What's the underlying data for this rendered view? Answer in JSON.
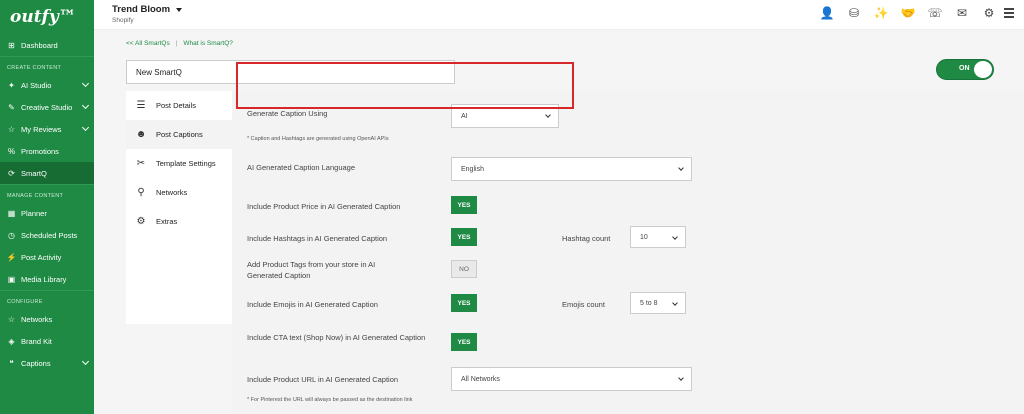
{
  "brand": {
    "logo": "outfy™"
  },
  "sidebar": {
    "items": [
      {
        "label": "Dashboard",
        "icon": "dashboard-icon"
      },
      {
        "section": "CREATE CONTENT"
      },
      {
        "label": "AI Studio",
        "icon": "ai-icon",
        "expandable": true
      },
      {
        "label": "Creative Studio",
        "icon": "brush-icon",
        "expandable": true
      },
      {
        "label": "My Reviews",
        "icon": "reviews-icon",
        "expandable": true
      },
      {
        "label": "Promotions",
        "icon": "promotions-icon"
      },
      {
        "label": "SmartQ",
        "icon": "smartq-icon",
        "active": true
      },
      {
        "section": "MANAGE CONTENT"
      },
      {
        "label": "Planner",
        "icon": "planner-icon"
      },
      {
        "label": "Scheduled Posts",
        "icon": "scheduled-icon"
      },
      {
        "label": "Post Activity",
        "icon": "activity-icon"
      },
      {
        "label": "Media Library",
        "icon": "media-icon"
      },
      {
        "section": "CONFIGURE"
      },
      {
        "label": "Networks",
        "icon": "networks-icon"
      },
      {
        "label": "Brand Kit",
        "icon": "brand-kit-icon"
      },
      {
        "label": "Captions",
        "icon": "captions-icon",
        "expandable": true
      }
    ]
  },
  "header": {
    "store_name": "Trend Bloom",
    "platform": "Shopify",
    "icons": [
      "user-icon",
      "database-icon",
      "magic-wand-icon",
      "handshake-icon",
      "support-icon",
      "inbox-icon",
      "gear-icon"
    ]
  },
  "breadcrumbs": {
    "back": "<< All SmartQs",
    "separator": "|",
    "help": "What is SmartQ?"
  },
  "smartq": {
    "name": "New SmartQ",
    "toggle_label": "ON"
  },
  "tabs": [
    {
      "label": "Post Details",
      "icon": "sliders-icon"
    },
    {
      "label": "Post Captions",
      "icon": "ai-head-icon",
      "active": true
    },
    {
      "label": "Template Settings",
      "icon": "tools-icon"
    },
    {
      "label": "Networks",
      "icon": "network-icon"
    },
    {
      "label": "Extras",
      "icon": "cog-icon"
    }
  ],
  "form": {
    "generate_caption": {
      "label": "Generate Caption Using",
      "value": "AI"
    },
    "ai_note": "* Caption and Hashtags are generated using OpenAI APIs",
    "language": {
      "label": "AI Generated Caption Language",
      "value": "English"
    },
    "include_price": {
      "label": "Include Product Price in AI Generated Caption",
      "value": "YES"
    },
    "include_hashtags": {
      "label": "Include Hashtags in AI Generated Caption",
      "value": "YES"
    },
    "hashtag_count": {
      "label": "Hashtag count",
      "value": "10"
    },
    "product_tags": {
      "label": "Add Product Tags from your store in AI Generated Caption",
      "value": "NO"
    },
    "include_emojis": {
      "label": "Include Emojis in AI Generated Caption",
      "value": "YES"
    },
    "emojis_count": {
      "label": "Emojis count",
      "value": "5 to 8"
    },
    "include_cta": {
      "label": "Include CTA text (Shop Now) in AI Generated Caption",
      "value": "YES"
    },
    "include_url": {
      "label": "Include Product URL in AI Generated Caption",
      "value": "All Networks"
    },
    "pinterest_note": "* For Pinterest the URL will always be passed as the destination link"
  },
  "colors": {
    "brand_green": "#1f8a44",
    "highlight_red": "#d62828"
  }
}
